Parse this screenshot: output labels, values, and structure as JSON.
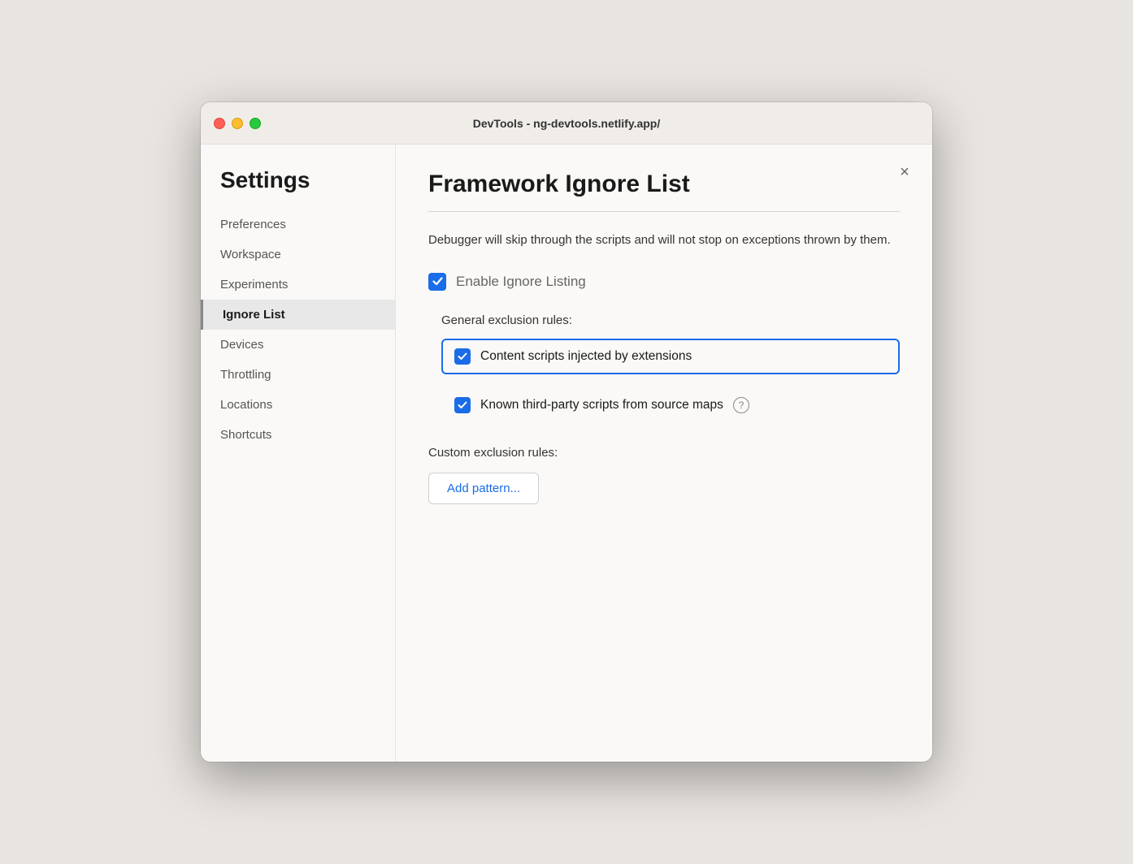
{
  "window": {
    "title": "DevTools - ng-devtools.netlify.app/"
  },
  "sidebar": {
    "heading": "Settings",
    "items": [
      {
        "id": "preferences",
        "label": "Preferences",
        "active": false
      },
      {
        "id": "workspace",
        "label": "Workspace",
        "active": false
      },
      {
        "id": "experiments",
        "label": "Experiments",
        "active": false
      },
      {
        "id": "ignore-list",
        "label": "Ignore List",
        "active": true
      },
      {
        "id": "devices",
        "label": "Devices",
        "active": false
      },
      {
        "id": "throttling",
        "label": "Throttling",
        "active": false
      },
      {
        "id": "locations",
        "label": "Locations",
        "active": false
      },
      {
        "id": "shortcuts",
        "label": "Shortcuts",
        "active": false
      }
    ]
  },
  "main": {
    "page_title": "Framework Ignore List",
    "description": "Debugger will skip through the scripts and will not stop on exceptions thrown by them.",
    "enable_ignore_listing_label": "Enable Ignore Listing",
    "enable_ignore_listing_checked": true,
    "general_exclusion_rules_label": "General exclusion rules:",
    "rules": [
      {
        "id": "content-scripts",
        "label": "Content scripts injected by extensions",
        "checked": true,
        "highlighted": true,
        "has_help": false
      },
      {
        "id": "third-party-scripts",
        "label": "Known third-party scripts from source maps",
        "checked": true,
        "highlighted": false,
        "has_help": true
      }
    ],
    "custom_exclusion_rules_label": "Custom exclusion rules:",
    "add_pattern_button_label": "Add pattern...",
    "close_button_label": "×"
  },
  "icons": {
    "checkmark": "✓",
    "close": "✕",
    "help": "?"
  }
}
